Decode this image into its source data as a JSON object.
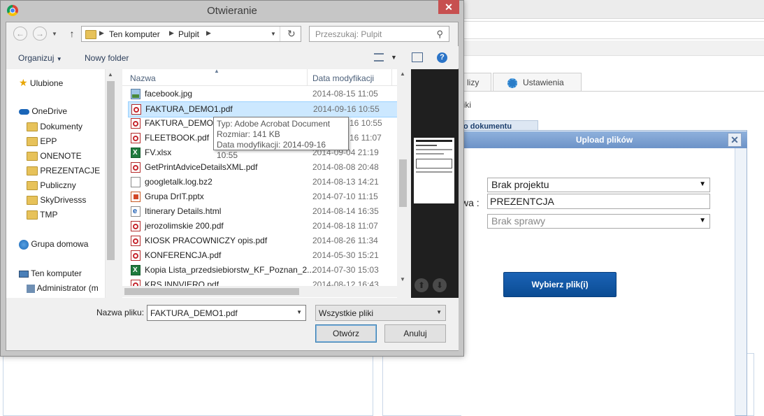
{
  "background_app": {
    "tabs": [
      "lizy",
      "Ustawienia"
    ],
    "fragment_pliki": "liki",
    "doc_strip": "o dokumentu",
    "upload_dialog": {
      "title": "Upload plików",
      "close": "✕",
      "project_select": "Brak projektu",
      "name_label": "wa :",
      "name_value": "PREZENTCJA",
      "case_select": "Brak sprawy",
      "choose_button": "Wybierz plik(i)"
    }
  },
  "dialog": {
    "title": "Otwieranie",
    "close_glyph": "✕",
    "breadcrumb": [
      "Ten komputer",
      "Pulpit"
    ],
    "search_placeholder": "Przeszukaj: Pulpit",
    "toolbar": {
      "organize": "Organizuj",
      "new_folder": "Nowy folder"
    },
    "nav": {
      "favorites": "Ulubione",
      "onedrive": "OneDrive",
      "onedrive_items": [
        "Dokumenty",
        "EPP",
        "ONENOTE",
        "PREZENTACJE",
        "Publiczny",
        "SkyDrivesss",
        "TMP"
      ],
      "homegroup": "Grupa domowa",
      "computer": "Ten komputer",
      "computer_items": [
        "Administrator (m"
      ]
    },
    "columns": {
      "name": "Nazwa",
      "date": "Data modyfikacji"
    },
    "files": [
      {
        "name": "facebook.jpg",
        "date": "2014-08-15 11:05",
        "type": "img"
      },
      {
        "name": "FAKTURA_DEMO1.pdf",
        "date": "2014-09-16 10:55",
        "type": "pdf",
        "selected": true
      },
      {
        "name": "FAKTURA_DEMO2",
        "date": "16 10:55",
        "type": "pdf"
      },
      {
        "name": "FLEETBOOK.pdf",
        "date": "16 11:07",
        "type": "pdf"
      },
      {
        "name": "FV.xlsx",
        "date": "2014-09-04 21:19",
        "type": "xls"
      },
      {
        "name": "GetPrintAdviceDetailsXML.pdf",
        "date": "2014-08-08 20:48",
        "type": "pdf"
      },
      {
        "name": "googletalk.log.bz2",
        "date": "2014-08-13 14:21",
        "type": "doc"
      },
      {
        "name": "Grupa DrIT.pptx",
        "date": "2014-07-10 11:15",
        "type": "ppt"
      },
      {
        "name": "Itinerary Details.html",
        "date": "2014-08-14 16:35",
        "type": "html"
      },
      {
        "name": "jerozolimskie 200.pdf",
        "date": "2014-08-18 11:07",
        "type": "pdf"
      },
      {
        "name": "KIOSK PRACOWNICZY opis.pdf",
        "date": "2014-08-26 11:34",
        "type": "pdf"
      },
      {
        "name": "KONFERENCJA.pdf",
        "date": "2014-05-30 15:21",
        "type": "pdf"
      },
      {
        "name": "Kopia Lista_przedsiebiorstw_KF_Poznan_2...",
        "date": "2014-07-30 15:03",
        "type": "xls"
      },
      {
        "name": "KRS INNVIERO.pdf",
        "date": "2014-08-12 16:43",
        "type": "pdf"
      }
    ],
    "tooltip": {
      "type": "Typ: Adobe Acrobat Document",
      "size": "Rozmiar: 141 KB",
      "date": "Data modyfikacji: 2014-09-16 10:55"
    },
    "bottom": {
      "filename_label": "Nazwa pliku:",
      "filename_value": "FAKTURA_DEMO1.pdf",
      "filter": "Wszystkie pliki",
      "open": "Otwórz",
      "cancel": "Anuluj"
    }
  }
}
